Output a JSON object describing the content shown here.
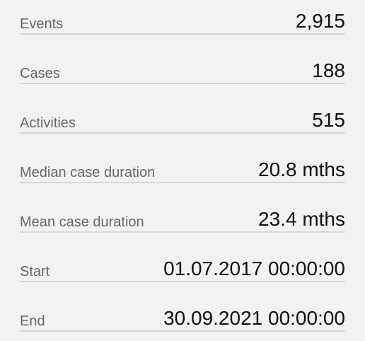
{
  "stats": [
    {
      "label": "Events",
      "value": "2,915"
    },
    {
      "label": "Cases",
      "value": "188"
    },
    {
      "label": "Activities",
      "value": "515"
    },
    {
      "label": "Median case duration",
      "value": "20.8 mths"
    },
    {
      "label": "Mean case duration",
      "value": "23.4 mths"
    },
    {
      "label": "Start",
      "value": "01.07.2017 00:00:00"
    },
    {
      "label": "End",
      "value": "30.09.2021 00:00:00"
    }
  ]
}
